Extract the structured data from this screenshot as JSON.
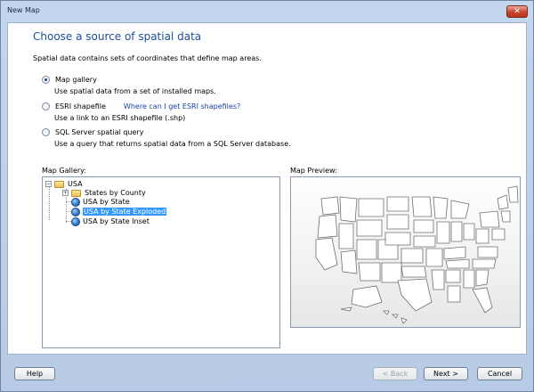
{
  "window": {
    "title": "New Map",
    "close_label": "✕"
  },
  "page": {
    "heading": "Choose a source of spatial data",
    "description": "Spatial data contains sets of coordinates that define map areas."
  },
  "sources": [
    {
      "label": "Map gallery",
      "hint": "Use spatial data from a set of installed maps.",
      "checked": true
    },
    {
      "label": "ESRI shapefile",
      "link": "Where can I get ESRI shapefiles?",
      "hint": "Use a link to an ESRI shapefile (.shp)",
      "checked": false
    },
    {
      "label": "SQL Server spatial query",
      "hint": "Use a query that returns spatial data from a SQL Server database.",
      "checked": false
    }
  ],
  "gallery": {
    "label": "Map Gallery:",
    "root": "USA",
    "items": [
      "States by County",
      "USA by State",
      "USA by State Exploded",
      "USA by State Inset"
    ],
    "selected_index": 2
  },
  "preview": {
    "label": "Map Preview:"
  },
  "buttons": {
    "help": "Help",
    "back": "< Back",
    "next": "Next >",
    "cancel": "Cancel"
  }
}
